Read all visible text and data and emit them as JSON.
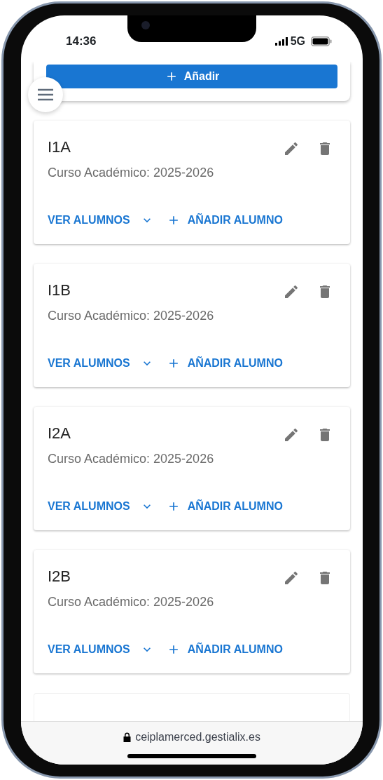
{
  "status_bar": {
    "time": "14:36",
    "network": "5G"
  },
  "add_button": {
    "label": "Añadir"
  },
  "groups": [
    {
      "name": "I1A",
      "subtitle": "Curso Académico: 2025-2026",
      "view_label": "VER ALUMNOS",
      "add_label": "AÑADIR ALUMNO",
      "expanded": false
    },
    {
      "name": "I1B",
      "subtitle": "Curso Académico: 2025-2026",
      "view_label": "VER ALUMNOS",
      "add_label": "AÑADIR ALUMNO",
      "expanded": false
    },
    {
      "name": "I2A",
      "subtitle": "Curso Académico: 2025-2026",
      "view_label": "VER ALUMNOS",
      "add_label": "AÑADIR ALUMNO",
      "expanded": false
    },
    {
      "name": "I2B",
      "subtitle": "Curso Académico: 2025-2026",
      "view_label": "VER ALUMNOS",
      "add_label": "AÑADIR ALUMNO",
      "expanded": false
    }
  ],
  "browser_bar": {
    "url": "ceiplamerced.gestialix.es"
  }
}
